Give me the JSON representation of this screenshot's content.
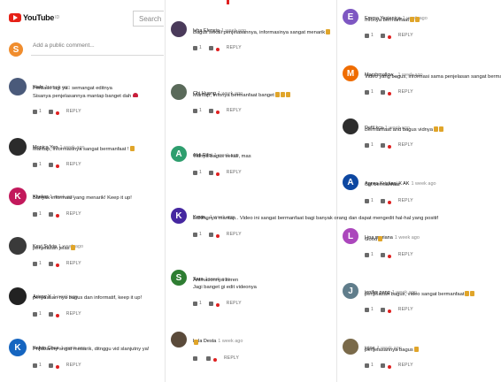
{
  "header": {
    "brand": "YouTube",
    "brand_sup": "ID",
    "search_placeholder": "Search"
  },
  "add_comment": {
    "avatar_letter": "S",
    "avatar_color": "#f08d2e",
    "placeholder": "Add a public comment..."
  },
  "reply_label": "REPLY",
  "colors": {
    "like_icon": "#6a6a6a",
    "heart": "#e02020",
    "emoji": "#e0a52a"
  },
  "column1": [
    {
      "author": "Kielz",
      "time": "1 week ago",
      "lines": [
        "Perbaiki lagi ya.. semangat editnya",
        "Sisanya penjelasannya mantap banget dah"
      ],
      "emoji": "red-heart",
      "likes": "1",
      "avatar": {
        "letter": "",
        "color": "#4a5a7a"
      }
    },
    {
      "author": "Monica Yen",
      "time": "1 week ago",
      "lines": [
        "Mantap, informasinya sangat bermanfaat !"
      ],
      "emoji": "thumbs-up-emoji",
      "likes": "1",
      "avatar": {
        "letter": "",
        "color": "#2b2b2b"
      }
    },
    {
      "author": "Khelen",
      "time": "1 week ago",
      "lines": [
        "Banyak informasi yang menarik! Keep it up!"
      ],
      "emoji": "",
      "likes": "1",
      "avatar": {
        "letter": "K",
        "color": "#c2185b"
      }
    },
    {
      "author": "Keyi Sylvia",
      "time": "1 week ago",
      "lines": [
        "penjelasan jelas"
      ],
      "emoji": "thumbs-up-emoji",
      "likes": "1",
      "avatar": {
        "letter": "",
        "color": "#3a3a3a"
      }
    },
    {
      "author": "Ariany Y",
      "time": "1 week ago",
      "lines": [
        "penjelasan nya bagus dan informatif, keep it up!"
      ],
      "emoji": "",
      "likes": "1",
      "avatar": {
        "letter": "",
        "color": "#222222"
      }
    },
    {
      "author": "Kelvin Chua",
      "time": "1 week ago",
      "lines": [
        "Pnjlasanny sngat menarik, ditnggu vid slanjutny ya!"
      ],
      "emoji": "",
      "likes": "1",
      "avatar": {
        "letter": "K",
        "color": "#1565c0"
      }
    }
  ],
  "column2": [
    {
      "author": "Ivha Elencia",
      "time": "1 week ago",
      "lines": [
        "Bagus sekali penjelasannya, informasinya sangat menarik"
      ],
      "emoji": "thumbs-up-emoji",
      "likes": "1",
      "avatar": {
        "letter": "",
        "color": "#4a3a5a"
      }
    },
    {
      "author": "Chi Huang",
      "time": "1 week ago",
      "lines": [
        "Mantap, Infonya bermanfaat banget"
      ],
      "emoji": "thumbs-up-emoji-x3",
      "likes": "1",
      "avatar": {
        "letter": "",
        "color": "#5a6a5a"
      }
    },
    {
      "author": "Aldi Rifqi",
      "time": "1 week ago",
      "lines": [
        "Vidnya bagus sekali, mas"
      ],
      "emoji": "",
      "likes": "1",
      "avatar": {
        "letter": "A",
        "color": "#2e9e6e"
      }
    },
    {
      "author": "Kevin_",
      "time": "1 week ago",
      "lines": [
        "Editingnya mantap.. Video ini sangat bermanfaat bagi banyak orang dan dapat mengedit hal-hal yang positif"
      ],
      "emoji": "",
      "likes": "1",
      "avatar": {
        "letter": "K",
        "color": "#4527a0"
      }
    },
    {
      "author": "Sara",
      "time": "1 week ago",
      "lines": [
        "Animationnya keren",
        "Jagi banget gi edit videonya"
      ],
      "emoji": "",
      "likes": "1",
      "avatar": {
        "letter": "S",
        "color": "#2e7d32"
      }
    },
    {
      "author": "Lala Desta",
      "time": "1 week ago",
      "lines": [
        ""
      ],
      "emoji": "thumbs-up-emoji",
      "likes": "",
      "avatar": {
        "letter": "",
        "color": "#5a4a3a"
      }
    }
  ],
  "column3": [
    {
      "author": "Emma Yesienica",
      "time": "1 week ago",
      "lines": [
        "Infonya bermanfaat"
      ],
      "emoji": "thumbs-up-emoji-x2",
      "likes": "1",
      "avatar": {
        "letter": "E",
        "color": "#7e57c2"
      }
    },
    {
      "author": "Marshmallow_",
      "time": "1 week ago",
      "lines": [
        "Video yang bagus, informasi sama penjelasan sangat bermanfaat"
      ],
      "emoji": "thumbs-up-emoji",
      "likes": "1",
      "avatar": {
        "letter": "M",
        "color": "#ef6c00"
      }
    },
    {
      "author": "Defil kcs",
      "time": "1 week ago",
      "lines": [
        "Bermanfaat and bagus vidnya"
      ],
      "emoji": "thumbs-up-emoji-x2",
      "likes": "1",
      "avatar": {
        "letter": "",
        "color": "#2d2d2d"
      }
    },
    {
      "author": "Agnes Kristiani X AK",
      "time": "1 week ago",
      "lines": [
        "Sgt bermanfaat"
      ],
      "emoji": "",
      "likes": "1",
      "avatar": {
        "letter": "A",
        "color": "#0d47a1"
      }
    },
    {
      "author": "Lina mariana",
      "time": "1 week ago",
      "lines": [
        "Good"
      ],
      "emoji": "thumbs-up-emoji",
      "likes": "1",
      "avatar": {
        "letter": "L",
        "color": "#ab47bc"
      }
    },
    {
      "author": "jenifer pang",
      "time": "1 week ago",
      "lines": [
        "penjelasan bagus, video sangat bermanfaat"
      ],
      "emoji": "thumbs-up-emoji-x2",
      "likes": "1",
      "avatar": {
        "letter": "J",
        "color": "#607d8b"
      }
    },
    {
      "author": "jojoe",
      "time": "1 week ago",
      "lines": [
        "penjelasannya bagus"
      ],
      "emoji": "thumbs-up-emoji",
      "likes": "1",
      "avatar": {
        "letter": "",
        "color": "#7a6a4a"
      }
    }
  ]
}
